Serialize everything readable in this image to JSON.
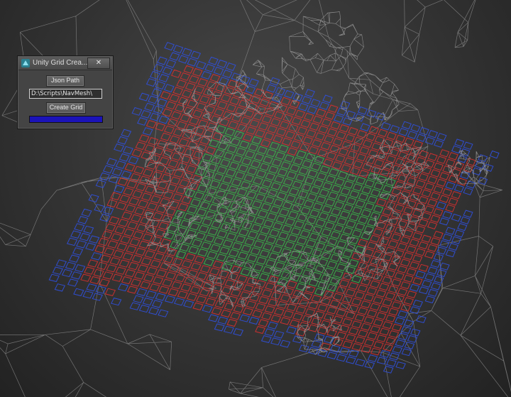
{
  "window": {
    "title": "Unity Grid Crea...",
    "close_label": "✕",
    "icon": "app-3d-icon"
  },
  "panel": {
    "json_path_button": "Json Path",
    "json_path_value": "D:\\Scripts\\NavMesh\\",
    "create_grid_button": "Create Grid",
    "progress": 1.0
  },
  "colors": {
    "grid_outer": "#2f4fd8",
    "grid_middle": "#d83030",
    "grid_inner": "#3ab84a",
    "mesh_wire": "#9a9a9a",
    "progress_fill": "#1b13b8"
  }
}
